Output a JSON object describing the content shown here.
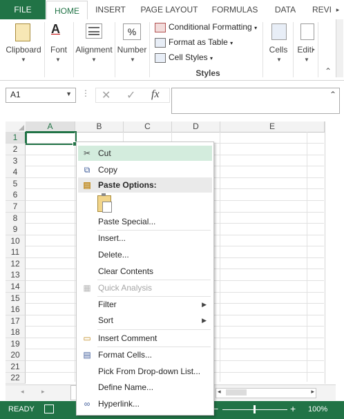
{
  "ribbon_tabs": [
    "FILE",
    "HOME",
    "INSERT",
    "PAGE LAYOUT",
    "FORMULAS",
    "DATA",
    "REVI"
  ],
  "ribbon": {
    "clipboard": "Clipboard",
    "font": "Font",
    "alignment": "Alignment",
    "number": "Number",
    "number_symbol": "%",
    "conditional_formatting": "Conditional Formatting",
    "format_as_table": "Format as Table",
    "cell_styles": "Cell Styles",
    "styles_group": "Styles",
    "cells": "Cells",
    "editing": "Editi"
  },
  "formula_bar": {
    "name_box": "A1",
    "cancel_symbol": "✕",
    "enter_symbol": "✓",
    "fx": "fx",
    "value": ""
  },
  "columns": [
    "A",
    "B",
    "C",
    "D",
    "E"
  ],
  "rows": [
    "1",
    "2",
    "3",
    "4",
    "5",
    "6",
    "7",
    "8",
    "9",
    "10",
    "11",
    "12",
    "13",
    "14",
    "15",
    "16",
    "17",
    "18",
    "19",
    "20",
    "21",
    "22"
  ],
  "context_menu": {
    "cut": "Cut",
    "copy": "Copy",
    "paste_options": "Paste Options:",
    "paste_special": "Paste Special...",
    "insert": "Insert...",
    "delete": "Delete...",
    "clear_contents": "Clear Contents",
    "quick_analysis": "Quick Analysis",
    "filter": "Filter",
    "sort": "Sort",
    "insert_comment": "Insert Comment",
    "format_cells": "Format Cells...",
    "pick_from_list": "Pick From Drop-down List...",
    "define_name": "Define Name...",
    "hyperlink": "Hyperlink..."
  },
  "status": {
    "ready": "READY",
    "zoom": "100%",
    "minus": "−",
    "plus": "+"
  },
  "colors": {
    "excel_green": "#217346",
    "menu_highlight": "#d3ecdd"
  }
}
